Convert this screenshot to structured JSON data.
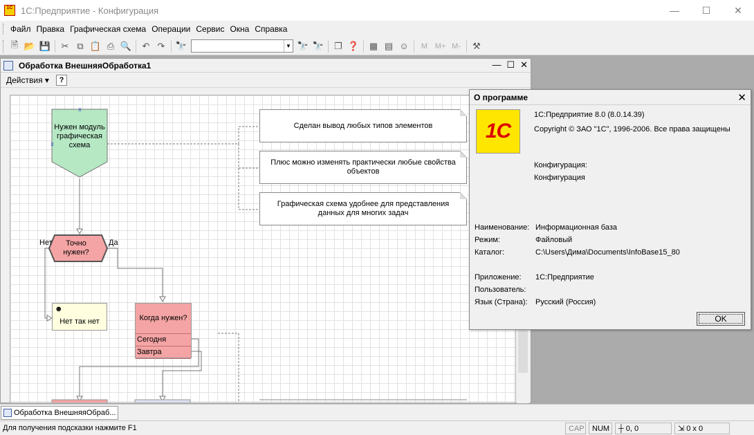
{
  "window": {
    "title": "1С:Предприятие - Конфигурация",
    "app_icon_text": "1C"
  },
  "menu": [
    "Файл",
    "Правка",
    "Графическая схема",
    "Операции",
    "Сервис",
    "Окна",
    "Справка"
  ],
  "toolbar": {
    "search_value": "",
    "m_buttons": [
      "M",
      "M+",
      "M-"
    ]
  },
  "document": {
    "title": "Обработка  ВнешняяОбработка1",
    "actions_label": "Действия",
    "help_label": "?"
  },
  "schema": {
    "start_node": "Нужен модуль графическая схема",
    "condition_node": "Точно нужен?",
    "label_no": "Нет",
    "label_yes": "Да",
    "net_node": "Нет так нет",
    "when_node": "Когда нужен?",
    "when_rows": [
      "Сегодня",
      "Завтра"
    ],
    "notes": [
      "Сделан вывод любых типов элементов",
      "Плюс можно изменять практически любые свойства объектов",
      "Графическая схема удобнее для представления данных для многих задач"
    ],
    "colors": {
      "start": "#b6e8c4",
      "condition": "#f4a4a4",
      "when": "#f4a4a4",
      "net": "#ffffe0"
    }
  },
  "about": {
    "title": "О программе",
    "version": "1С:Предприятие 8.0 (8.0.14.39)",
    "copyright": "Copyright © ЗАО \"1С\", 1996-2006. Все права защищены",
    "config_label": "Конфигурация:",
    "config_value": "Конфигурация",
    "name_label": "Наименование:",
    "name_value": "Информационная база",
    "mode_label": "Режим:",
    "mode_value": "Файловый",
    "catalog_label": "Каталог:",
    "catalog_value": "C:\\Users\\Дима\\Documents\\InfoBase15_80",
    "app_label": "Приложение:",
    "app_value": "1С:Предприятие",
    "user_label": "Пользователь:",
    "user_value": "",
    "lang_label": "Язык (Страна):",
    "lang_value": "Русский (Россия)",
    "ok_label": "OK",
    "logo_text": "1C"
  },
  "taskbar": {
    "tab_label": "Обработка  ВнешняяОбраб..."
  },
  "status": {
    "hint": "Для получения подсказки нажмите F1",
    "cap": "CAP",
    "num": "NUM",
    "position": "0, 0",
    "size": "0 x 0"
  }
}
